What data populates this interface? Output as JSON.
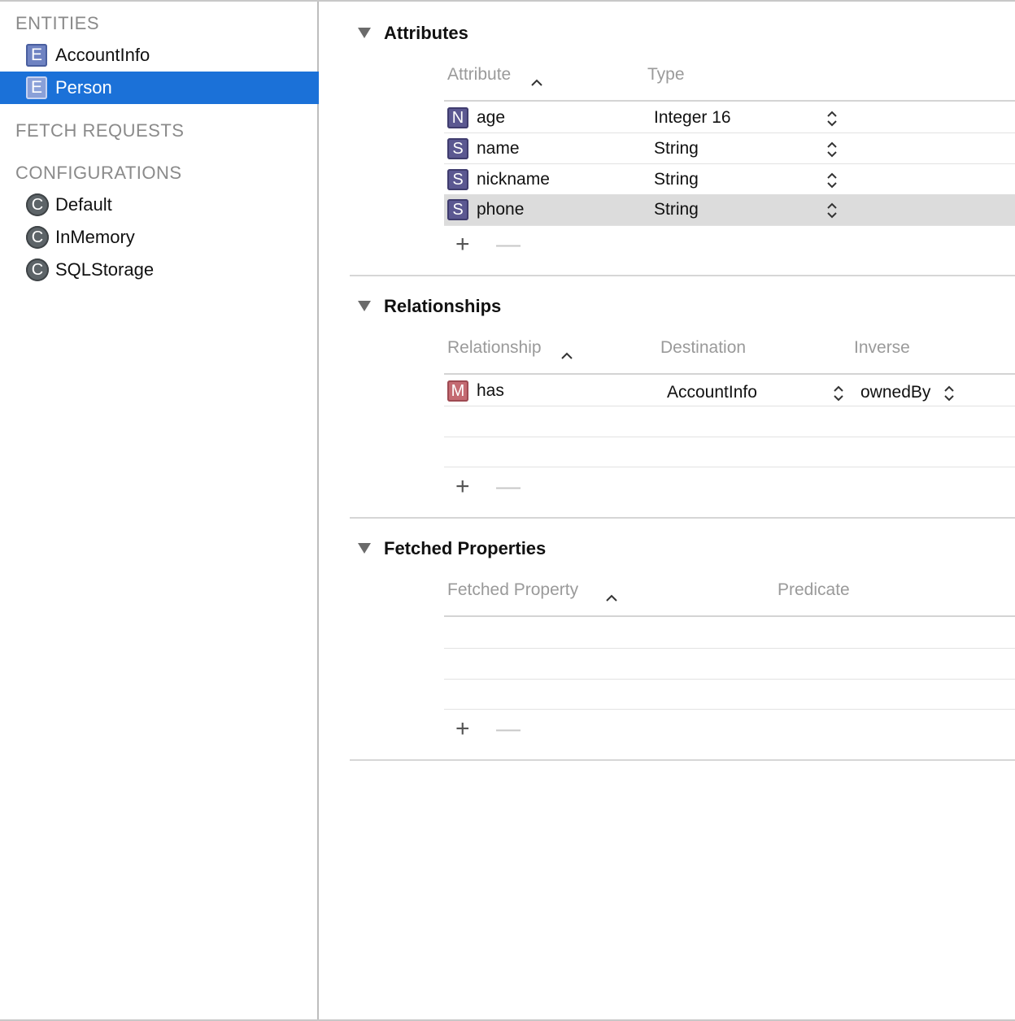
{
  "sidebar": {
    "entities_header": "ENTITIES",
    "entities": [
      {
        "badge": "E",
        "label": "AccountInfo",
        "selected": false
      },
      {
        "badge": "E",
        "label": "Person",
        "selected": true
      }
    ],
    "fetch_requests_header": "FETCH REQUESTS",
    "configurations_header": "CONFIGURATIONS",
    "configurations": [
      {
        "badge": "C",
        "label": "Default"
      },
      {
        "badge": "C",
        "label": "InMemory"
      },
      {
        "badge": "C",
        "label": "SQLStorage"
      }
    ]
  },
  "attributes": {
    "title": "Attributes",
    "col_attribute": "Attribute",
    "col_type": "Type",
    "rows": [
      {
        "badge": "N",
        "name": "age",
        "type": "Integer 16"
      },
      {
        "badge": "S",
        "name": "name",
        "type": "String"
      },
      {
        "badge": "S",
        "name": "nickname",
        "type": "String"
      },
      {
        "badge": "S",
        "name": "phone",
        "type": "String"
      }
    ],
    "add": "+",
    "remove": "—"
  },
  "relationships": {
    "title": "Relationships",
    "col_relationship": "Relationship",
    "col_destination": "Destination",
    "col_inverse": "Inverse",
    "rows": [
      {
        "badge": "M",
        "name": "has",
        "destination": "AccountInfo",
        "inverse": "ownedBy"
      }
    ],
    "add": "+",
    "remove": "—"
  },
  "fetched_properties": {
    "title": "Fetched Properties",
    "col_fetched_property": "Fetched Property",
    "col_predicate": "Predicate",
    "add": "+",
    "remove": "—"
  },
  "colors": {
    "selection": "#1b71d8",
    "entity_badge": "#6f83c2",
    "attribute_badge": "#5b5891",
    "relationship_badge": "#c46a72"
  }
}
